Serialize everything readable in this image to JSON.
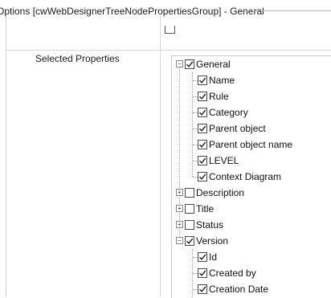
{
  "header": {
    "title": "Options [cwWebDesignerTreeNodePropertiesGroup] - General"
  },
  "field": {
    "label": "Selected Properties"
  },
  "tree": {
    "general": {
      "label": "General",
      "checked": true,
      "expanded": true,
      "children": [
        "Name",
        "Rule",
        "Category",
        "Parent object",
        "Parent object name",
        "LEVEL",
        "Context Diagram"
      ]
    },
    "description": {
      "label": "Description",
      "checked": false
    },
    "title": {
      "label": "Title",
      "checked": false
    },
    "status": {
      "label": "Status",
      "checked": false
    },
    "version": {
      "label": "Version",
      "checked": true,
      "expanded": true,
      "children": [
        "Id",
        "Created by",
        "Creation Date"
      ]
    }
  }
}
